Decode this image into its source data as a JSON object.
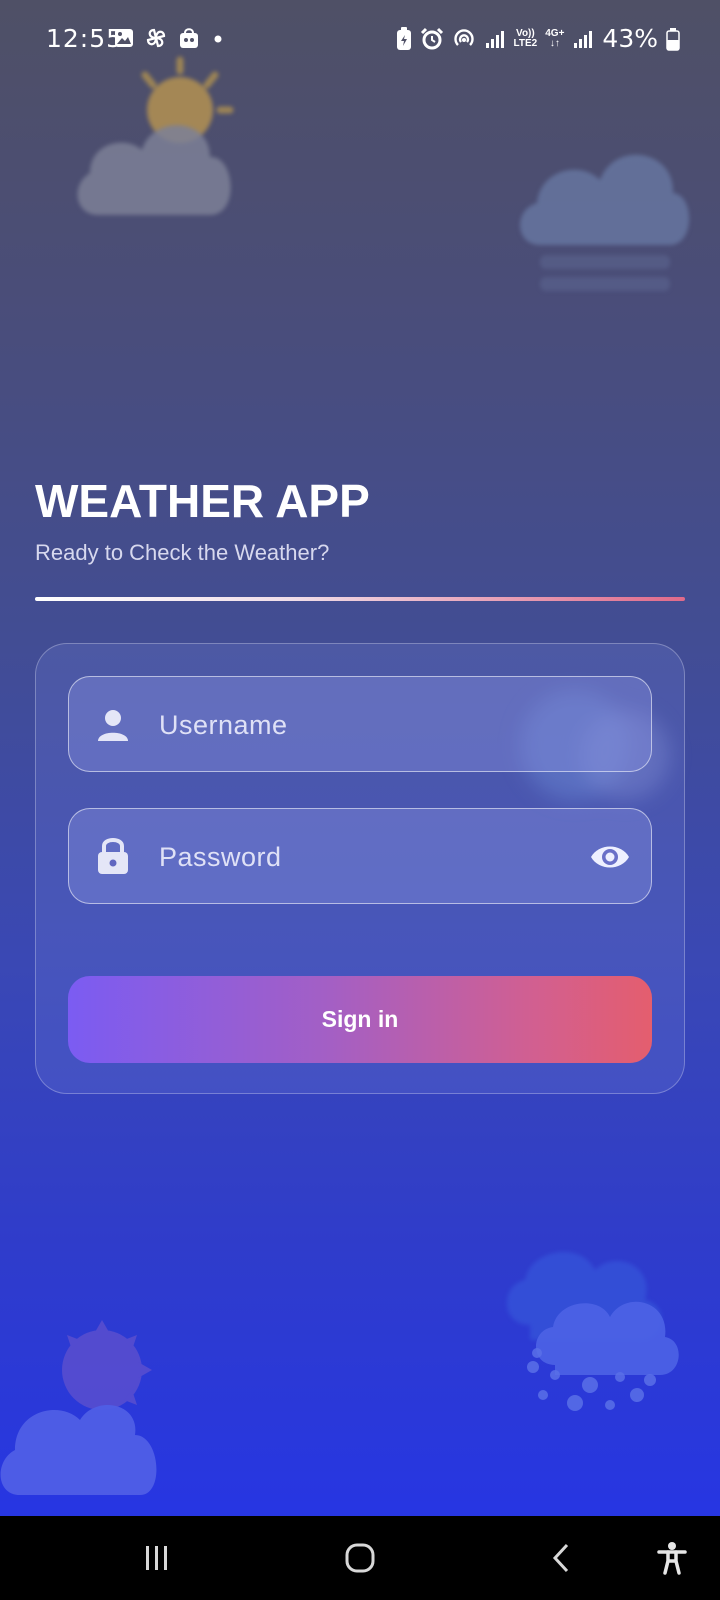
{
  "status_bar": {
    "time": "12:55",
    "battery_percent": "43%",
    "network_label_top": "Vo))",
    "network_label_bottom": "LTE2",
    "network_type_top": "4G+",
    "network_type_bottom": "↓↑",
    "left_icons": [
      "gallery-icon",
      "pinwheel-icon",
      "shopping-bag-icon",
      "notification-dot-icon"
    ],
    "right_icons": [
      "battery-saver-icon",
      "alarm-icon",
      "hotspot-icon",
      "signal-icon",
      "signal-icon",
      "battery-icon"
    ]
  },
  "header": {
    "title": "WEATHER APP",
    "subtitle": "Ready to Check the Weather?"
  },
  "login_form": {
    "username": {
      "placeholder": "Username",
      "icon": "user-icon"
    },
    "password": {
      "placeholder": "Password",
      "icon": "lock-icon",
      "toggle_icon": "eye-icon"
    },
    "submit_label": "Sign in"
  },
  "colors": {
    "background_top": "#4f5066",
    "background_bottom": "#2434ea",
    "button_gradient_start": "#7b5cf2",
    "button_gradient_end": "#e45e6e",
    "text_primary": "#ffffff"
  },
  "decorations": [
    "sun-cloud-icon",
    "rain-cloud-icon",
    "cloud-icon",
    "snow-cloud-icon",
    "sun-cloud-icon"
  ],
  "nav_bar": {
    "buttons": [
      "recent-apps-icon",
      "home-icon",
      "back-icon",
      "accessibility-icon"
    ]
  }
}
